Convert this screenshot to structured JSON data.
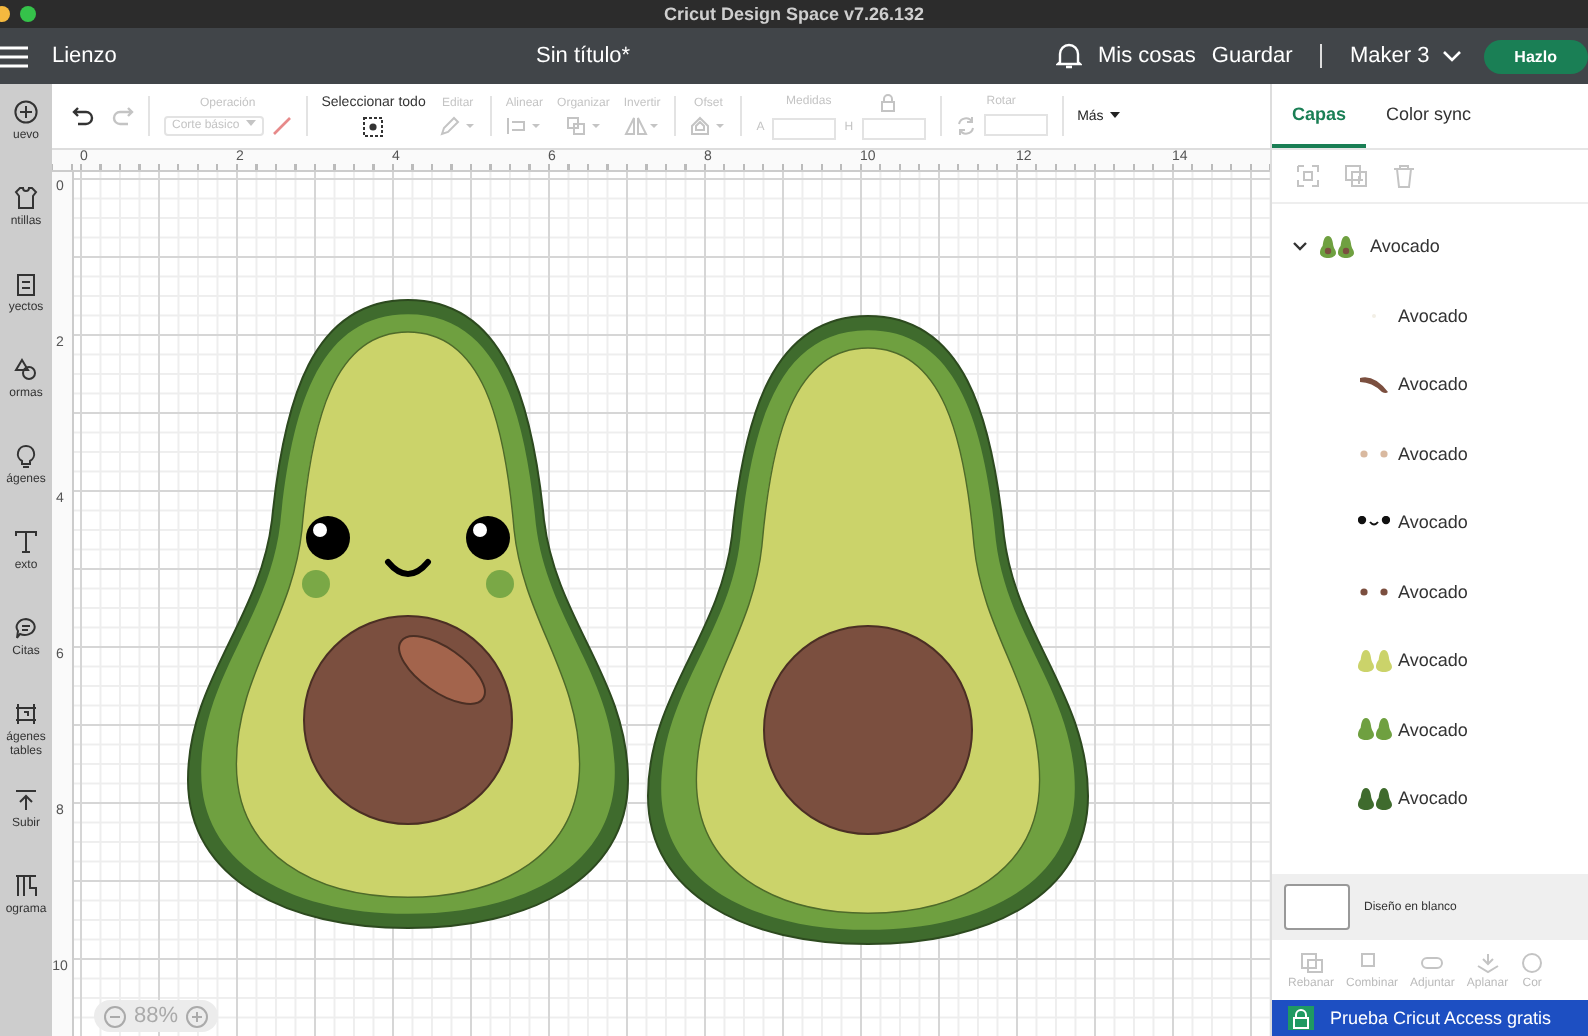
{
  "window": {
    "title": "Cricut Design Space  v7.26.132"
  },
  "header": {
    "section": "Lienzo",
    "document_title": "Sin título*",
    "links": [
      "Mis cosas",
      "Guardar"
    ],
    "machine": "Maker 3",
    "make_button": "Hazlo"
  },
  "sidebar": {
    "items": [
      {
        "kind": "new",
        "label": "uevo"
      },
      {
        "kind": "templates",
        "label": "ntillas"
      },
      {
        "kind": "projects",
        "label": "yectos"
      },
      {
        "kind": "shapes",
        "label": "ormas"
      },
      {
        "kind": "images",
        "label": "ágenes"
      },
      {
        "kind": "text",
        "label": "exto"
      },
      {
        "kind": "phrases",
        "label": "Citas"
      },
      {
        "kind": "editable",
        "label": "ágenes",
        "label_2": "tables"
      },
      {
        "kind": "upload",
        "label": "Subir"
      },
      {
        "kind": "program",
        "label": "ograma"
      }
    ]
  },
  "toolbar": {
    "undo": {
      "disabled": false
    },
    "redo": {
      "disabled": true
    },
    "operation": {
      "label": "Operación",
      "value": "Corte básico",
      "disabled": true
    },
    "select_all": {
      "label": "Seleccionar todo",
      "disabled": false
    },
    "tools": [
      {
        "kind": "edit",
        "label": "Editar",
        "disabled": true
      },
      {
        "kind": "align",
        "label": "Alinear",
        "disabled": true
      },
      {
        "kind": "arrange",
        "label": "Organizar",
        "disabled": true
      },
      {
        "kind": "flip",
        "label": "Invertir",
        "disabled": true
      },
      {
        "kind": "offset",
        "label": "Ofset",
        "disabled": true
      }
    ],
    "size": {
      "label": "Medidas",
      "width_label": "A",
      "height_label": "H",
      "disabled": true
    },
    "rotate": {
      "label": "Rotar",
      "disabled": true
    },
    "more": {
      "label": "Más"
    }
  },
  "rulers": {
    "horizontal": [
      "0",
      "2",
      "4",
      "6",
      "8",
      "10",
      "12",
      "14"
    ],
    "vertical": [
      "0",
      "2",
      "4",
      "6",
      "8",
      "10"
    ]
  },
  "zoom": {
    "value": "88%"
  },
  "layers_panel": {
    "tabs": [
      {
        "label": "Capas",
        "selected": true
      },
      {
        "label": "Color sync",
        "selected": false
      }
    ],
    "layer_tools": [
      {
        "kind": "ungroup",
        "disabled": true
      },
      {
        "kind": "duplicate",
        "disabled": true
      },
      {
        "kind": "delete",
        "disabled": true
      }
    ],
    "group": {
      "name": "Avocado",
      "expanded": true,
      "kind": "avocado-pair",
      "children": [
        {
          "name": "Avocado",
          "kind": "speck",
          "color": "#f2efe6"
        },
        {
          "name": "Avocado",
          "kind": "seed",
          "color": "#7b4f3f"
        },
        {
          "name": "Avocado",
          "kind": "dots",
          "color": "#d9b9a0"
        },
        {
          "name": "Avocado",
          "kind": "face",
          "color": "#111111"
        },
        {
          "name": "Avocado",
          "kind": "dots",
          "color": "#7b4f3f"
        },
        {
          "name": "Avocado",
          "kind": "pears",
          "color": "#cbd36a"
        },
        {
          "name": "Avocado",
          "kind": "pears",
          "color": "#6fa040"
        },
        {
          "name": "Avocado",
          "kind": "pears",
          "color": "#3f6b2d"
        }
      ]
    }
  },
  "blank_design": {
    "label": "Diseño en blanco"
  },
  "actions": [
    {
      "kind": "slice",
      "label": "Rebanar",
      "disabled": true
    },
    {
      "kind": "combine",
      "label": "Combinar",
      "disabled": true
    },
    {
      "kind": "attach",
      "label": "Adjuntar",
      "disabled": true
    },
    {
      "kind": "flatten",
      "label": "Aplanar",
      "disabled": true
    },
    {
      "kind": "contour",
      "label": "Cor",
      "disabled": true
    }
  ],
  "banner": {
    "text": "Prueba Cricut Access gratis"
  }
}
